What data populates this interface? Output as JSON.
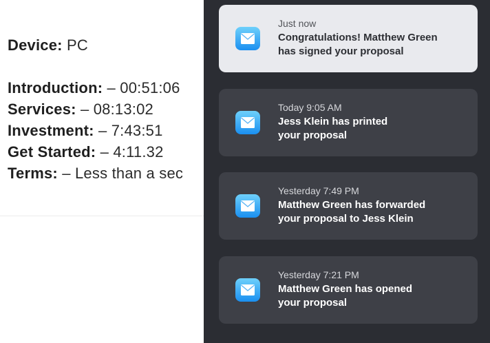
{
  "document": {
    "device": {
      "label": "Device:",
      "value": " PC"
    },
    "sections": [
      {
        "label": "Introduction:",
        "value": " – 00:51:06"
      },
      {
        "label": "Services:",
        "value": " – 08:13:02"
      },
      {
        "label": "Investment:",
        "value": " – 7:43:51"
      },
      {
        "label": "Get Started:",
        "value": " – 4:11.32"
      },
      {
        "label": "Terms:",
        "value": " – Less than a sec"
      }
    ]
  },
  "notifications": [
    {
      "time": "Just now",
      "line1": "Congratulations! Matthew Green",
      "line2": "has signed your proposal",
      "icon": "mail-icon"
    },
    {
      "time": "Today 9:05 AM",
      "line1": "Jess Klein has printed",
      "line2": "your proposal",
      "icon": "mail-icon"
    },
    {
      "time": "Yesterday 7:49 PM",
      "line1": "Matthew Green has forwarded",
      "line2": "your proposal to Jess Klein",
      "icon": "mail-icon"
    },
    {
      "time": "Yesterday 7:21 PM",
      "line1": "Matthew Green has opened",
      "line2": "your proposal",
      "icon": "mail-icon"
    }
  ],
  "colors": {
    "panel_bg": "#2b2d33",
    "card_bg": "#3e4047",
    "card_highlight_bg": "#e9eaee",
    "mail_icon_gradient": [
      "#6ed0fb",
      "#1a8ff0"
    ]
  }
}
